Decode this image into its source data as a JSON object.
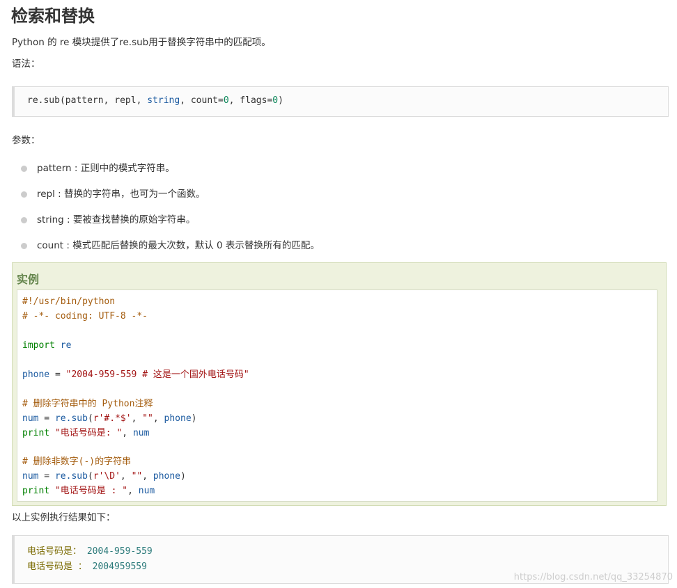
{
  "title": "检索和替换",
  "intro": "Python 的 re 模块提供了re.sub用于替换字符串中的匹配项。",
  "syntax_label": "语法：",
  "syntax": {
    "fn": "re.sub",
    "open": "(",
    "arg1": "pattern",
    "comma1": ", ",
    "arg2": "repl",
    "comma2": ", ",
    "arg3": "string",
    "comma3": ", ",
    "arg4": "count",
    "eq1": "=",
    "v1": "0",
    "comma4": ", ",
    "arg5": "flags",
    "eq2": "=",
    "v2": "0",
    "close": ")"
  },
  "params_label": "参数：",
  "params": [
    "pattern : 正则中的模式字符串。",
    "repl : 替换的字符串，也可为一个函数。",
    "string : 要被查找替换的原始字符串。",
    "count : 模式匹配后替换的最大次数，默认 0 表示替换所有的匹配。"
  ],
  "example": {
    "title": "实例",
    "code": {
      "l1": "#!/usr/bin/python",
      "l2": "# -*- coding: UTF-8 -*-",
      "l4_kw": "import",
      "l4_mod": " re",
      "l6_var": "phone",
      "l6_eq": " = ",
      "l6_str": "\"2004-959-559 # 这是一个国外电话号码\"",
      "l8": "# 删除字符串中的 Python注释",
      "l9_var": "num",
      "l9_eq": " = ",
      "l9_fn": "re.sub",
      "l9_open": "(",
      "l9_str1": "r'#.*$'",
      "l9_c1": ", ",
      "l9_str2": "\"\"",
      "l9_c2": ", ",
      "l9_arg": "phone",
      "l9_close": ")",
      "l10_kw": "print",
      "l10_str": " \"电话号码是: \"",
      "l10_c": ", ",
      "l10_var": "num",
      "l12": "# 删除非数字(-)的字符串",
      "l13_var": "num",
      "l13_eq": " = ",
      "l13_fn": "re.sub",
      "l13_open": "(",
      "l13_str1": "r'\\D'",
      "l13_c1": ", ",
      "l13_str2": "\"\"",
      "l13_c2": ", ",
      "l13_arg": "phone",
      "l13_close": ")",
      "l14_kw": "print",
      "l14_str": " \"电话号码是 : \"",
      "l14_c": ", ",
      "l14_var": "num"
    }
  },
  "result_label": "以上实例执行结果如下：",
  "output": [
    {
      "label": "电话号码是：",
      "value": "2004-959-559"
    },
    {
      "label": "电话号码是 ：",
      "value": "2004959559"
    }
  ],
  "watermark": "https://blog.csdn.net/qq_33254870"
}
